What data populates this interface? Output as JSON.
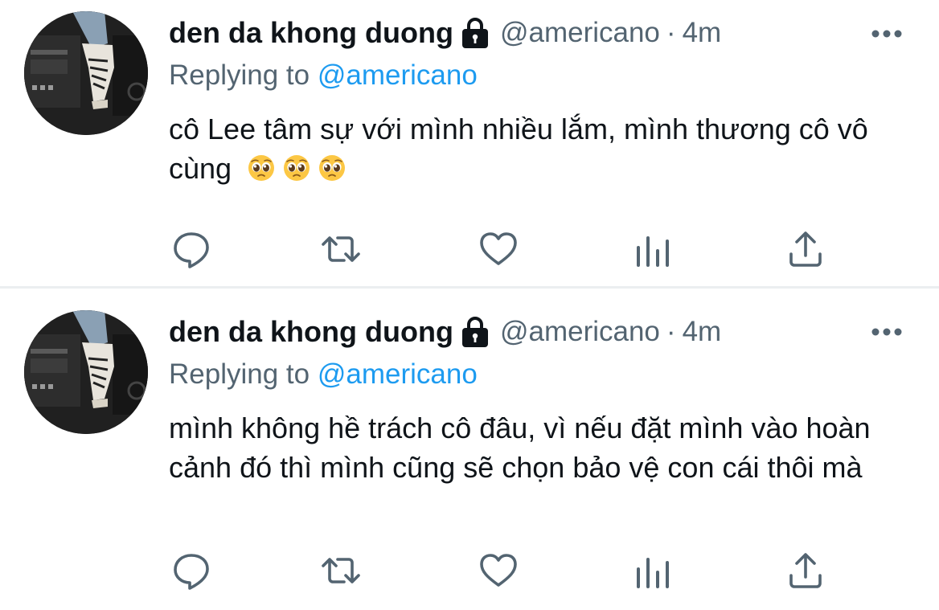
{
  "tweets": [
    {
      "display_name": "den da khong duong",
      "handle": "@americano",
      "separator": "·",
      "time": "4m",
      "replying_prefix": "Replying to",
      "replying_to": "@americano",
      "text": "cô Lee tâm sự với mình nhiều lắm, mình thương cô vô cùng",
      "emojis": [
        "pleading-face",
        "pleading-face",
        "pleading-face"
      ],
      "actions": [
        "reply-icon",
        "retweet-icon",
        "like-icon",
        "views-icon",
        "share-icon"
      ]
    },
    {
      "display_name": "den da khong duong",
      "handle": "@americano",
      "separator": "·",
      "time": "4m",
      "replying_prefix": "Replying to",
      "replying_to": "@americano",
      "text": "mình không hề trách cô đâu, vì nếu đặt mình vào hoàn cảnh đó thì mình cũng sẽ chọn bảo vệ con cái thôi mà",
      "emojis": [],
      "actions": [
        "reply-icon",
        "retweet-icon",
        "like-icon",
        "views-icon",
        "share-icon"
      ]
    }
  ],
  "colors": {
    "text": "#0f1419",
    "secondary": "#536471",
    "accent": "#1d9bf0",
    "divider": "#ebeef0"
  }
}
